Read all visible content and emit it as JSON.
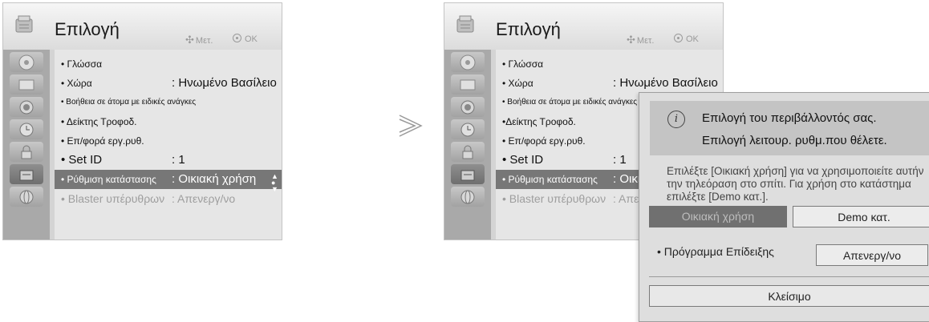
{
  "left_menu": {
    "title": "Επιλογή",
    "hint_move": "Μετ.",
    "hint_ok": "OK",
    "items": [
      {
        "label": "• Γλώσσα",
        "value": ""
      },
      {
        "label": "• Χώρα",
        "value": ": Ηνωμένο Βασίλειο"
      },
      {
        "label": "• Βοήθεια σε άτομα με ειδικές ανάγκες",
        "value": ""
      },
      {
        "label": "• Δείκτης Τροφοδ.",
        "value": ""
      },
      {
        "label": "• Επ/φορά εργ.ρυθ.",
        "value": ""
      },
      {
        "label": "• Set ID",
        "value": ": 1"
      },
      {
        "label": "• Ρύθμιση κατάστασης",
        "value": ": Οικιακή χρήση"
      },
      {
        "label": "• Blaster υπέρυθρων",
        "value": ": Απενεργ/νο"
      }
    ]
  },
  "right_menu": {
    "title": "Επιλογή",
    "hint_move": "Μετ.",
    "hint_ok": "OK",
    "items": [
      {
        "label": "• Γλώσσα",
        "value": ""
      },
      {
        "label": "• Χώρα",
        "value": ": Ηνωμένο Βασίλειο"
      },
      {
        "label": "• Βοήθεια σε άτομα με ειδικές ανάγκες",
        "value": ""
      },
      {
        "label": "•Δείκτης Τροφοδ.",
        "value": ""
      },
      {
        "label": "• Επ/φορά εργ.ρυθ.",
        "value": ""
      },
      {
        "label": "• Set ID",
        "value": ": 1"
      },
      {
        "label": "• Ρύθμιση κατάστασης",
        "value": ": Οικιακή χρήση"
      },
      {
        "label": "• Blaster υπέρυθρων",
        "value": ": Απενεργ/νο"
      }
    ]
  },
  "popup": {
    "line1": "Επιλογή του περιβάλλοντός σας.",
    "line2": "Επιλογή λειτουρ. ρυθμ.που θέλετε.",
    "description": "Επιλέξτε [Οικιακή χρήση] για να χρησιμοποιείτε αυτήν την τηλεόραση στο σπίτι. Για χρήση στο κατάστημα επιλέξτε [Demo κατ.].",
    "home_button": "Οικιακή χρήση",
    "demo_button": "Demo κατ.",
    "demo_program_label": "• Πρόγραμμα Επίδειξης",
    "demo_program_value": "Απενεργ/νο",
    "close_button": "Κλείσιμο"
  },
  "colors": {
    "selected_row": "#777777",
    "disabled_text": "#9e9e9e",
    "sidebar": "#a9a9a9"
  }
}
